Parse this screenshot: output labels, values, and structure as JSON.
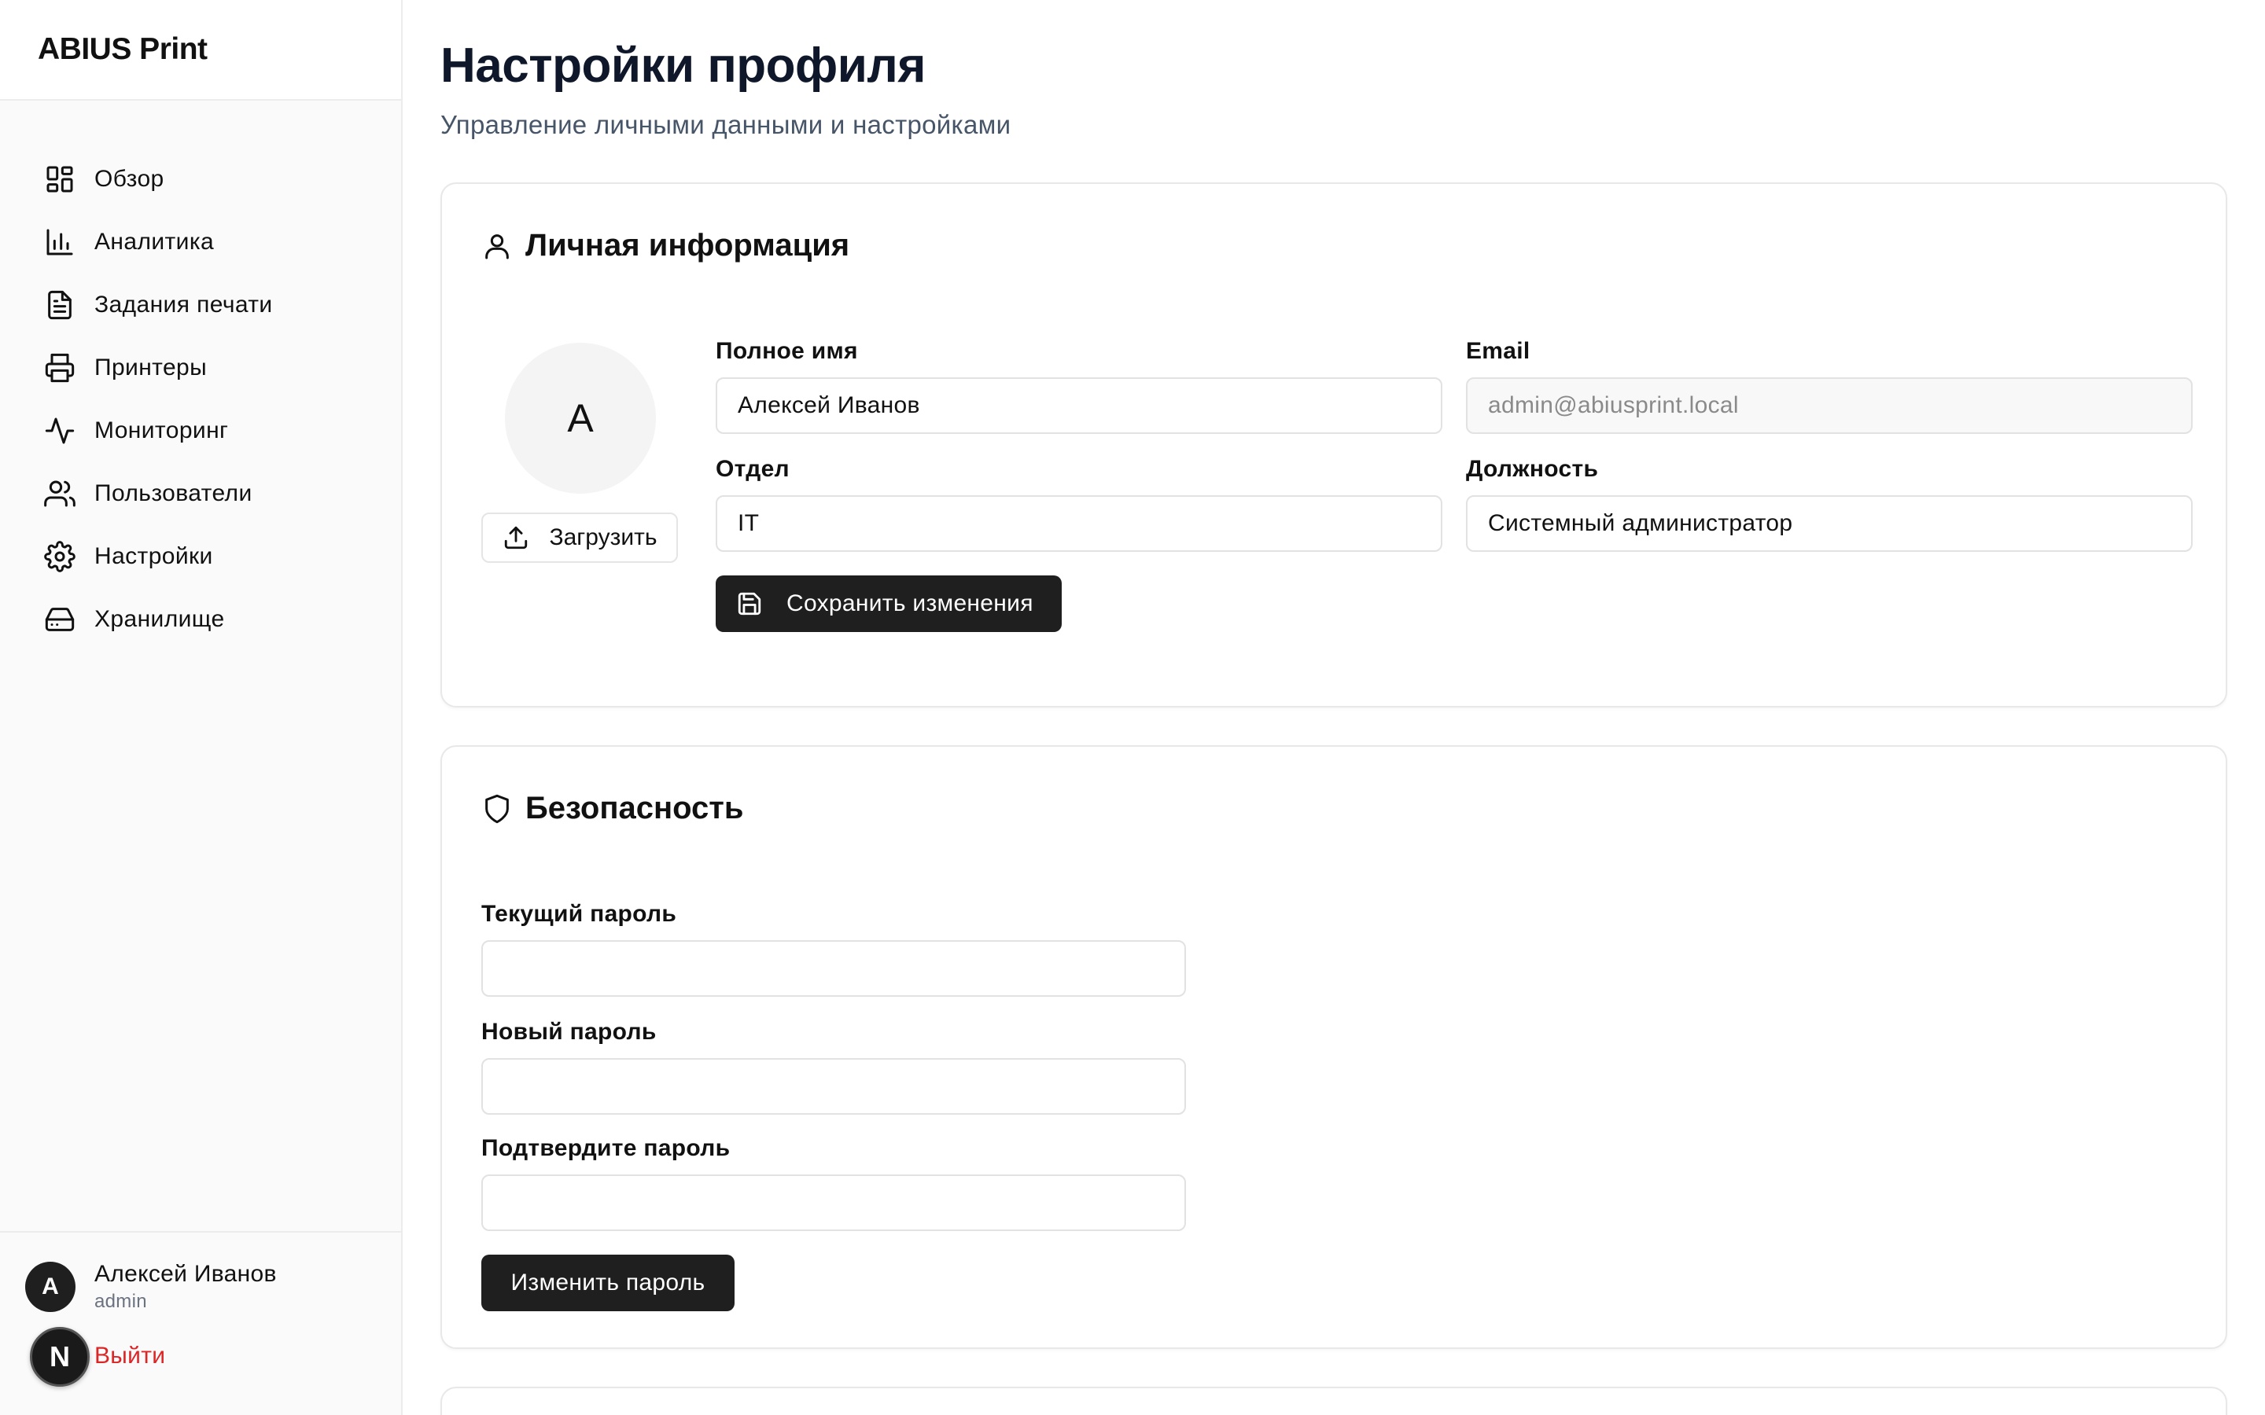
{
  "sidebar": {
    "brand": "ABIUS Print",
    "items": [
      {
        "label": "Обзор",
        "icon": "dashboard-icon"
      },
      {
        "label": "Аналитика",
        "icon": "bar-chart-icon"
      },
      {
        "label": "Задания печати",
        "icon": "file-text-icon"
      },
      {
        "label": "Принтеры",
        "icon": "printer-icon"
      },
      {
        "label": "Мониторинг",
        "icon": "activity-icon"
      },
      {
        "label": "Пользователи",
        "icon": "users-icon"
      },
      {
        "label": "Настройки",
        "icon": "gear-icon"
      },
      {
        "label": "Хранилище",
        "icon": "hard-drive-icon"
      }
    ],
    "user": {
      "initial": "A",
      "name": "Алексей Иванов",
      "role": "admin"
    },
    "logo_letter": "N",
    "logout_label": "Выйти"
  },
  "page": {
    "title": "Настройки профиля",
    "subtitle": "Управление личными данными и настройками"
  },
  "personal": {
    "title": "Личная информация",
    "avatar_initial": "A",
    "upload_label": "Загрузить",
    "full_name_label": "Полное имя",
    "full_name_value": "Алексей Иванов",
    "email_label": "Email",
    "email_value": "admin@abiusprint.local",
    "department_label": "Отдел",
    "department_value": "IT",
    "position_label": "Должность",
    "position_value": "Системный администратор",
    "save_label": "Сохранить изменения"
  },
  "security": {
    "title": "Безопасность",
    "current_password_label": "Текущий пароль",
    "new_password_label": "Новый пароль",
    "confirm_password_label": "Подтвердите пароль",
    "change_label": "Изменить пароль"
  },
  "colors": {
    "accent_dark": "#1f1f1f",
    "danger": "#dc2626",
    "muted_text": "#475569"
  }
}
